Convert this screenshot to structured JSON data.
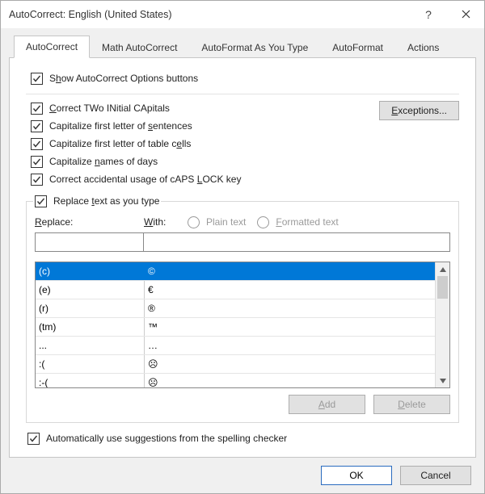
{
  "window": {
    "title": "AutoCorrect: English (United States)"
  },
  "tabs": {
    "t0": "AutoCorrect",
    "t1": "Math AutoCorrect",
    "t2": "AutoFormat As You Type",
    "t3": "AutoFormat",
    "t4": "Actions"
  },
  "top": {
    "showOptions_pre": "S",
    "showOptions_u": "h",
    "showOptions_post": "ow AutoCorrect Options buttons"
  },
  "opts": {
    "o1_pre": "",
    "o1_u": "C",
    "o1_post": "orrect TWo INitial CApitals",
    "o2_pre": "Capitalize first letter of ",
    "o2_u": "s",
    "o2_post": "entences",
    "o3_pre": "Capitalize first letter of table c",
    "o3_u": "e",
    "o3_post": "lls",
    "o4_pre": "Capitalize ",
    "o4_u": "n",
    "o4_post": "ames of days",
    "o5_pre": "Correct accidental usage of cAPS ",
    "o5_u": "L",
    "o5_post": "OCK key",
    "exceptions_u": "E",
    "exceptions_post": "xceptions..."
  },
  "replace": {
    "legend_pre": "Replace ",
    "legend_u": "t",
    "legend_post": "ext as you type",
    "replace_u": "R",
    "replace_post": "eplace:",
    "with_u": "W",
    "with_post": "ith:",
    "plain": "Plain text",
    "formatted_u": "F",
    "formatted_post": "ormatted text",
    "input1": "",
    "input2": "",
    "rows": [
      {
        "a": "(c)",
        "b": "©"
      },
      {
        "a": "(e)",
        "b": "€"
      },
      {
        "a": "(r)",
        "b": "®"
      },
      {
        "a": "(tm)",
        "b": "™"
      },
      {
        "a": "...",
        "b": "…"
      },
      {
        "a": ":(",
        "b": "☹"
      },
      {
        "a": ":-(",
        "b": "☹"
      }
    ],
    "add_u": "A",
    "add_post": "dd",
    "delete_u": "D",
    "delete_post": "elete"
  },
  "checker": {
    "pre": "Automatically use su",
    "u": "g",
    "post": "gestions from the spelling checker"
  },
  "dlg": {
    "ok": "OK",
    "cancel": "Cancel"
  }
}
